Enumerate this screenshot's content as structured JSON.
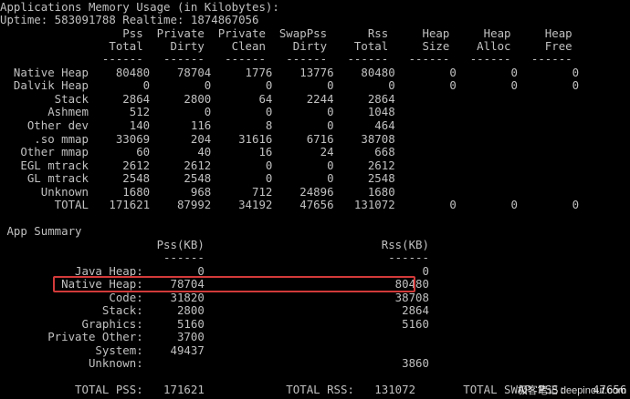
{
  "terminal": {
    "header": "Applications Memory Usage (in Kilobytes):",
    "uptime": "Uptime: 583091788 Realtime: 1874867056",
    "table_head_1": "                  Pss  Private  Private  SwapPss      Rss     Heap     Heap     Heap",
    "table_head_2": "                Total    Dirty    Clean    Dirty    Total     Size    Alloc     Free",
    "table_rule": "               ------   ------   ------   ------   ------   ------   ------   ------",
    "rows": [
      "  Native Heap    80480    78704     1776    13776    80480        0        0        0",
      "  Dalvik Heap        0        0        0        0        0        0        0        0",
      "        Stack     2864     2800       64     2244     2864",
      "       Ashmem      512        0        0        0     1048",
      "    Other dev      140      116        8        0      464",
      "     .so mmap    33069      204    31616     6716    38708",
      "   Other mmap       60       40       16       24      668",
      "   EGL mtrack     2612     2612        0        0     2612",
      "    GL mtrack     2548     2548        0        0     2548",
      "      Unknown     1680      968      712    24896     1680",
      "        TOTAL   171621    87992    34192    47656   131072        0        0        0"
    ],
    "summary_title": " App Summary",
    "summary_head": "                       Pss(KB)                          Rss(KB)",
    "summary_rule": "                        ------                           ------",
    "summary_rows": [
      "           Java Heap:        0                                0",
      "         Native Heap:    78704                            80480",
      "                Code:    31820                            38708",
      "               Stack:     2800                             2864",
      "            Graphics:     5160                             5160",
      "       Private Other:     3700",
      "              System:    49437",
      "             Unknown:                                      3860"
    ],
    "summary_total": "           TOTAL PSS:   171621            TOTAL RSS:   131072       TOTAL SWAP PSS:    47656"
  },
  "watermark": "极客笔记 deepinout.com",
  "colors": {
    "background": "#000000",
    "text": "#c0c0c0",
    "highlight_border": "#d23a3a"
  }
}
